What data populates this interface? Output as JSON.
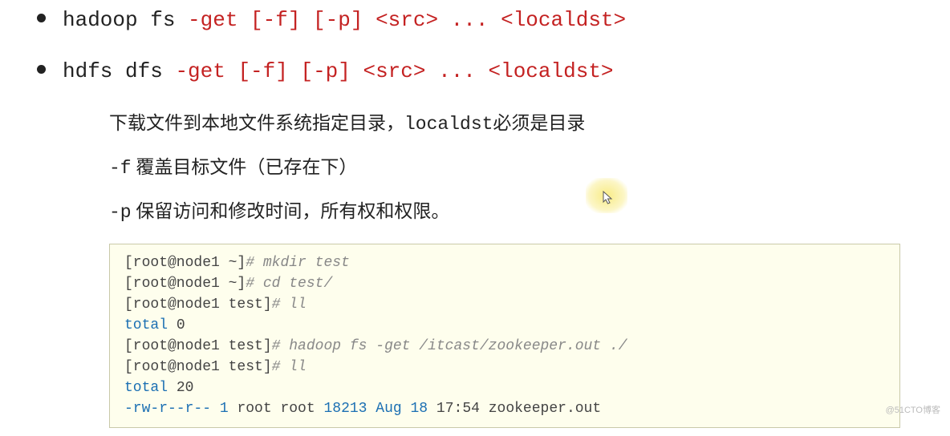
{
  "bullets": [
    {
      "cmd_plain": "hadoop fs ",
      "cmd_flag": "-get [-f] [-p] <src> ... <localdst>"
    },
    {
      "cmd_plain": "hdfs dfs ",
      "cmd_flag": "-get [-f] [-p] <src> ... <localdst>"
    }
  ],
  "desc": {
    "line1_a": "下载文件到本地文件系统指定目录，",
    "line1_b": "localdst",
    "line1_c": "必须是目录",
    "line2_a": "-f",
    "line2_b": " 覆盖目标文件（已存在下）",
    "line3_a": "-p",
    "line3_b": " 保留访问和修改时间，所有权和权限。"
  },
  "terminal": {
    "p1": "[root@node1 ~]",
    "c1": "# mkdir test",
    "p2": "[root@node1 ~]",
    "c2": "# cd test/",
    "p3": "[root@node1 test]",
    "c3": "# ll",
    "t1a": "total",
    "t1b": " 0",
    "p4": "[root@node1 test]",
    "c4": "# hadoop fs -get /itcast/zookeeper.out ./",
    "p5": "[root@node1 test]",
    "c5": "# ll",
    "t2a": "total",
    "t2b": " 20",
    "ls_perm": "-rw-r--r--",
    "ls_links": " 1",
    "ls_owner": " root root ",
    "ls_size": "18213",
    "ls_date": " Aug 18",
    "ls_rest": " 17:54 zookeeper.out"
  },
  "watermark": "@51CTO博客"
}
